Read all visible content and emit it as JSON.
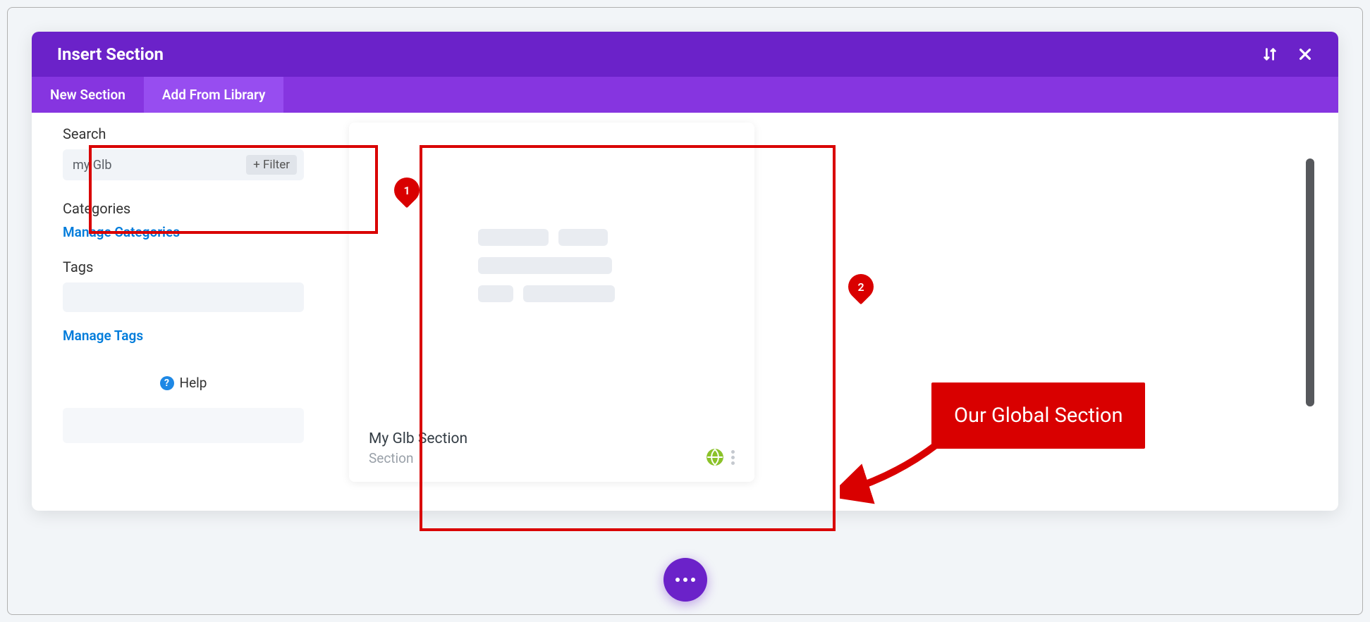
{
  "modal": {
    "title": "Insert Section",
    "tabs": [
      "New Section",
      "Add From Library"
    ]
  },
  "sidebar": {
    "search_label": "Search",
    "search_value": "my Glb",
    "filter_button": "+ Filter",
    "categories_label": "Categories",
    "manage_categories": "Manage Categories",
    "tags_label": "Tags",
    "manage_tags": "Manage Tags",
    "help_label": "Help"
  },
  "card": {
    "title": "My Glb Section",
    "subtitle": "Section"
  },
  "annotations": {
    "marker1": "1",
    "marker2": "2",
    "callout": "Our Global Section"
  }
}
